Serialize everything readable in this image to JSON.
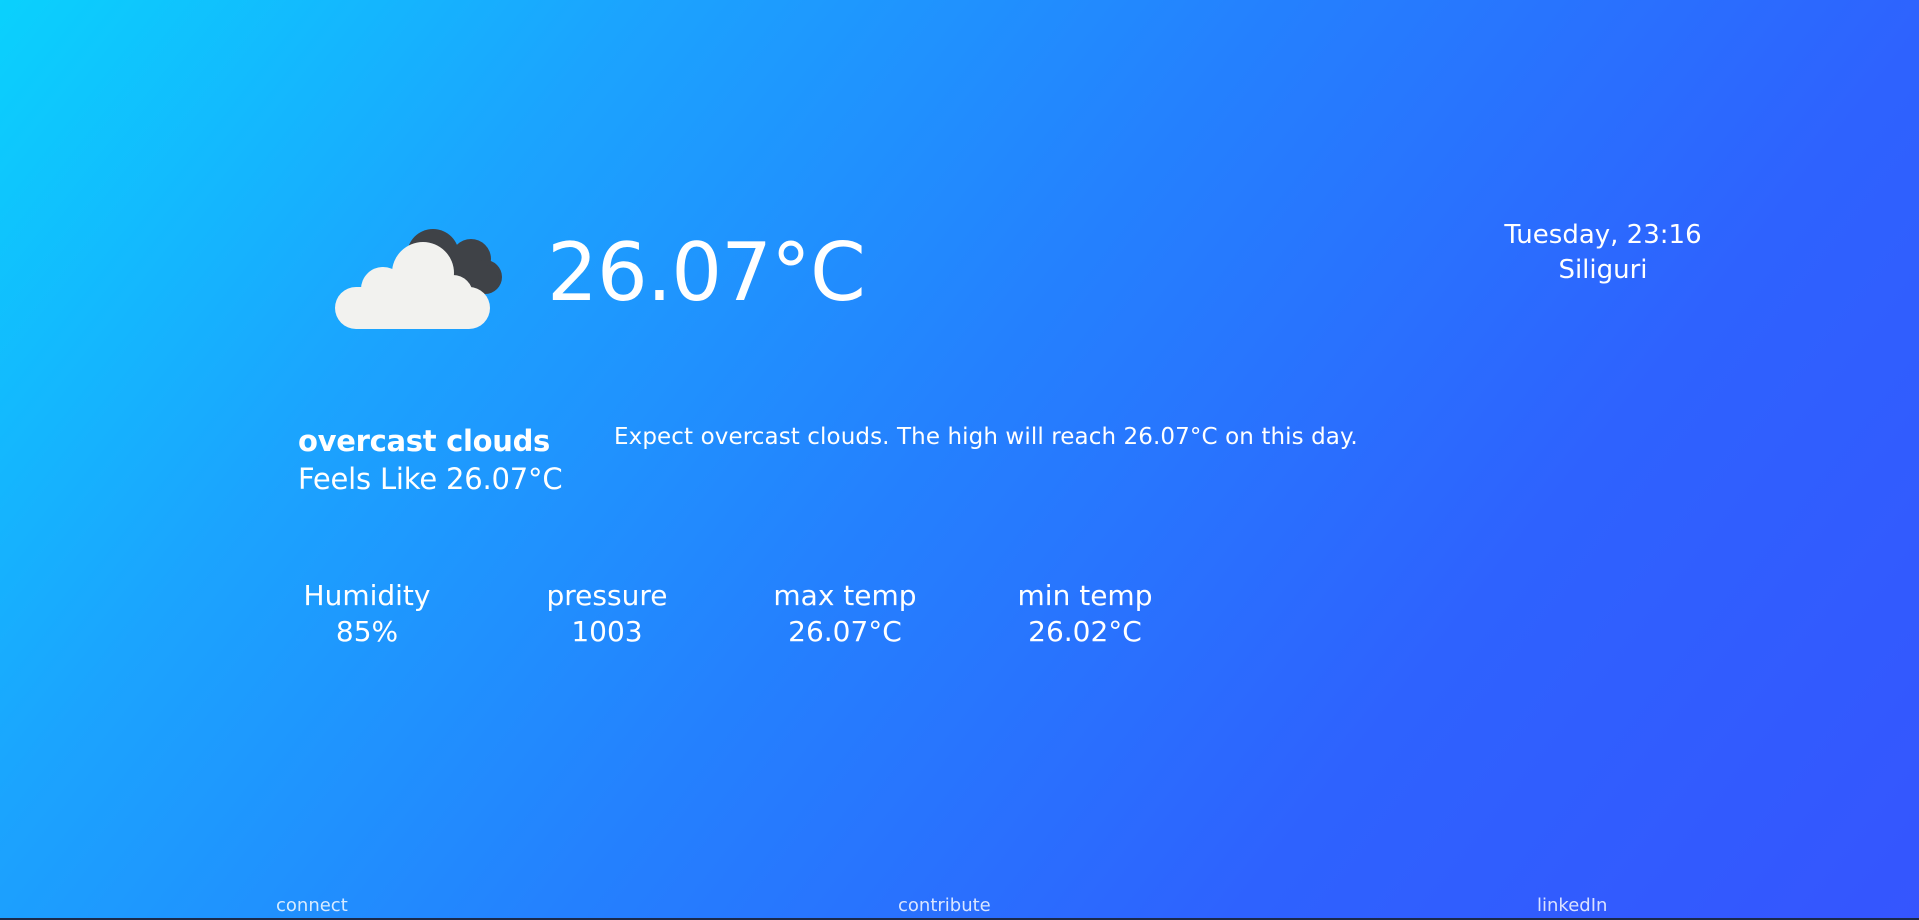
{
  "current": {
    "icon": "overcast-clouds-icon",
    "temperature": "26.07°C"
  },
  "header": {
    "datetime": "Tuesday, 23:16",
    "city": "Siliguri"
  },
  "conditions": {
    "description": "overcast clouds",
    "feels_like": "Feels Like 26.07°C"
  },
  "summary": "Expect overcast clouds. The high will reach 26.07°C on this day.",
  "stats": {
    "humidity": {
      "label": "Humidity",
      "value": "85%"
    },
    "pressure": {
      "label": "pressure",
      "value": "1003"
    },
    "max_temp": {
      "label": "max temp",
      "value": "26.07°C"
    },
    "min_temp": {
      "label": "min temp",
      "value": "26.02°C"
    }
  },
  "footer": {
    "connect": "connect",
    "contribute": "contribute",
    "linkedin": "linkedIn"
  },
  "colors": {
    "gradient_start": "#0ad1fd",
    "gradient_end": "#3555fe",
    "text": "#ffffff",
    "cloud_light": "#f2f2ef",
    "cloud_dark": "#3f4247"
  }
}
